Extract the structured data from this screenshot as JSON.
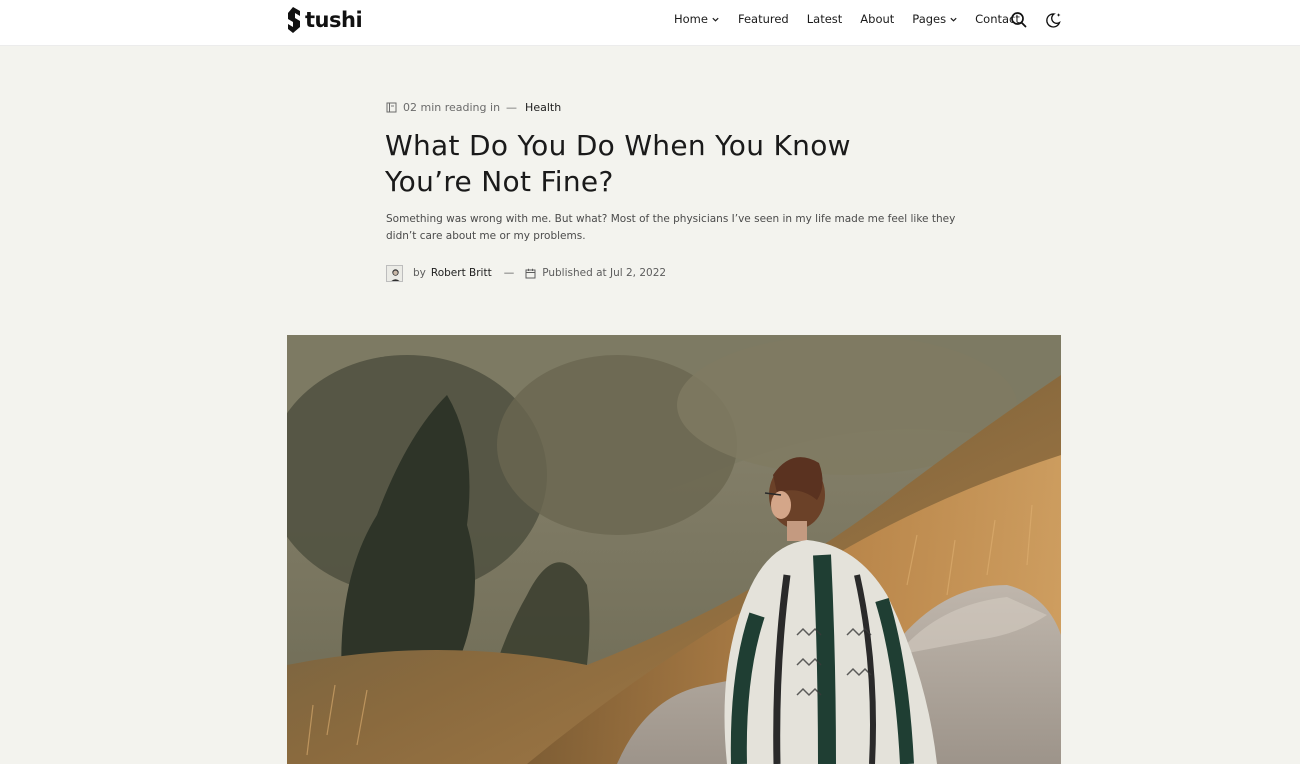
{
  "site": {
    "logo_text": "tushi"
  },
  "nav": {
    "items": [
      {
        "label": "Home",
        "has_dropdown": true
      },
      {
        "label": "Featured",
        "has_dropdown": false
      },
      {
        "label": "Latest",
        "has_dropdown": false
      },
      {
        "label": "About",
        "has_dropdown": false
      },
      {
        "label": "Pages",
        "has_dropdown": true
      },
      {
        "label": "Contact",
        "has_dropdown": false
      }
    ],
    "search_icon": "search-icon",
    "theme_icon": "moon-icon"
  },
  "article": {
    "reading_time": "02 min reading in",
    "separator": "—",
    "category": "Health",
    "title": "What Do You Do When You Know You’re Not Fine?",
    "excerpt": "Something was wrong with me. But what? Most of the physicians I’ve seen in my life made me feel like they didn’t care about me or my problems.",
    "author_prefix": "by",
    "author": "Robert Britt",
    "published": "Published at Jul 2, 2022"
  },
  "colors": {
    "page_bg": "#f3f3ee",
    "header_bg": "#ffffff",
    "text": "#1d1d1d"
  }
}
